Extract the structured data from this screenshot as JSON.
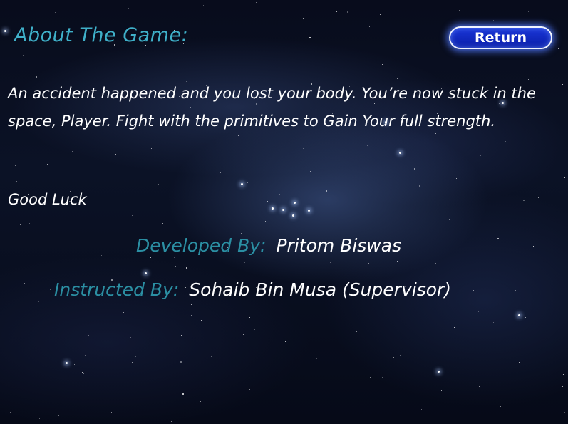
{
  "screen": {
    "heading": "About The Game:",
    "return_label": "Return",
    "story": "An accident happened and you lost your body. You’re now stuck in the space, Player. Fight with the primitives to Gain Your full strength.",
    "good_luck": "Good Luck",
    "credits": [
      {
        "label": "Developed By:",
        "value": "Pritom Biswas"
      },
      {
        "label": "Instructed By:",
        "value": "Sohaib Bin Musa (Supervisor)"
      }
    ]
  },
  "colors": {
    "heading": "#3fb0c9",
    "credit_label": "#2b8fa3",
    "body_text": "#ffffff",
    "button_fill": "#1a36d8",
    "button_glow": "#5078ff"
  },
  "icons": [
    "starfield-background"
  ]
}
